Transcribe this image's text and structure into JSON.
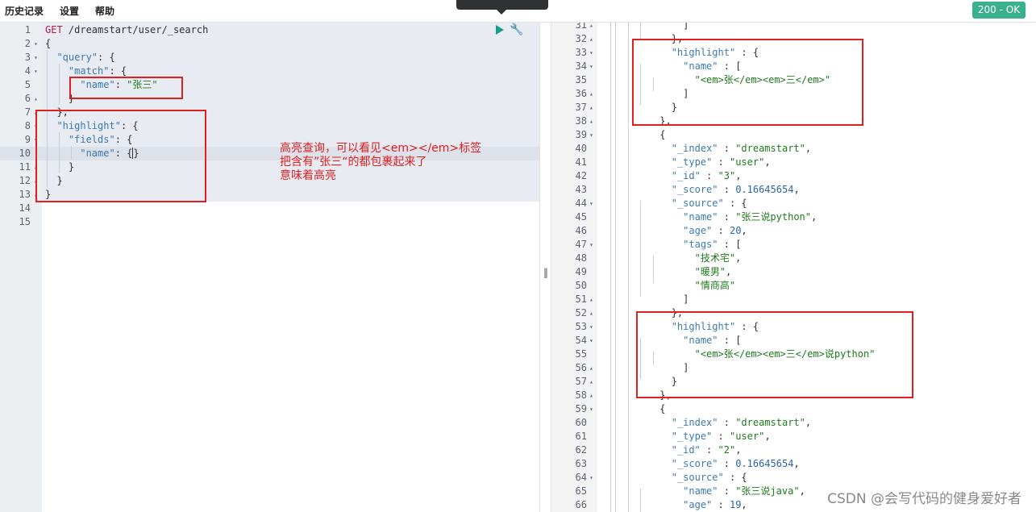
{
  "menu": {
    "history": "历史记录",
    "settings": "设置",
    "help": "帮助"
  },
  "status": "200 - OK",
  "request": {
    "lines": [
      {
        "n": "1",
        "fold": "",
        "html": "<span class='m'>GET</span> /dreamstart/user/_search"
      },
      {
        "n": "2",
        "fold": "▾",
        "html": "{"
      },
      {
        "n": "3",
        "fold": "▾",
        "html": "  <span class='k'>\"query\"</span>: {"
      },
      {
        "n": "4",
        "fold": "▾",
        "html": "    <span class='k'>\"match\"</span>: {"
      },
      {
        "n": "5",
        "fold": "",
        "html": "      <span class='k'>\"name\"</span>: <span class='s'>\"张三\"</span>"
      },
      {
        "n": "6",
        "fold": "▴",
        "html": "    }"
      },
      {
        "n": "7",
        "fold": "▴",
        "html": "  },"
      },
      {
        "n": "8",
        "fold": "▾",
        "html": "  <span class='k'>\"highlight\"</span>: {"
      },
      {
        "n": "9",
        "fold": "▾",
        "html": "    <span class='k'>\"fields\"</span>: {"
      },
      {
        "n": "10",
        "fold": "",
        "html": "      <span class='k'>\"name\"</span>: {|}"
      },
      {
        "n": "11",
        "fold": "▴",
        "html": "    }"
      },
      {
        "n": "12",
        "fold": "▴",
        "html": "  }"
      },
      {
        "n": "13",
        "fold": "▴",
        "html": "}"
      },
      {
        "n": "14",
        "fold": "",
        "html": ""
      },
      {
        "n": "15",
        "fold": "",
        "html": ""
      }
    ]
  },
  "note": {
    "line1": "高亮查询，可以看见<em></em>标签",
    "line2": "把含有”张三“的都包裹起来了",
    "line3": "意味着高亮"
  },
  "response": {
    "lines": [
      {
        "n": "31",
        "fold": "▴",
        "html": "              ]"
      },
      {
        "n": "32",
        "fold": "▴",
        "html": "            },"
      },
      {
        "n": "33",
        "fold": "▾",
        "html": "            <span class='k'>\"highlight\"</span> : {"
      },
      {
        "n": "34",
        "fold": "▾",
        "html": "              <span class='k'>\"name\"</span> : ["
      },
      {
        "n": "35",
        "fold": "",
        "html": "                <span class='s'>\"&lt;em&gt;张&lt;/em&gt;&lt;em&gt;三&lt;/em&gt;\"</span>"
      },
      {
        "n": "36",
        "fold": "▴",
        "html": "              ]"
      },
      {
        "n": "37",
        "fold": "▴",
        "html": "            }"
      },
      {
        "n": "38",
        "fold": "▴",
        "html": "          },"
      },
      {
        "n": "39",
        "fold": "▾",
        "html": "          {"
      },
      {
        "n": "40",
        "fold": "",
        "html": "            <span class='k'>\"_index\"</span> : <span class='s'>\"dreamstart\"</span>,"
      },
      {
        "n": "41",
        "fold": "",
        "html": "            <span class='k'>\"_type\"</span> : <span class='s'>\"user\"</span>,"
      },
      {
        "n": "42",
        "fold": "",
        "html": "            <span class='k'>\"_id\"</span> : <span class='s'>\"3\"</span>,"
      },
      {
        "n": "43",
        "fold": "",
        "html": "            <span class='k'>\"_score\"</span> : <span class='n'>0.16645654</span>,"
      },
      {
        "n": "44",
        "fold": "▾",
        "html": "            <span class='k'>\"_source\"</span> : {"
      },
      {
        "n": "45",
        "fold": "",
        "html": "              <span class='k'>\"name\"</span> : <span class='s'>\"张三说python\"</span>,"
      },
      {
        "n": "46",
        "fold": "",
        "html": "              <span class='k'>\"age\"</span> : <span class='n'>20</span>,"
      },
      {
        "n": "47",
        "fold": "▾",
        "html": "              <span class='k'>\"tags\"</span> : ["
      },
      {
        "n": "48",
        "fold": "",
        "html": "                <span class='s'>\"技术宅\"</span>,"
      },
      {
        "n": "49",
        "fold": "",
        "html": "                <span class='s'>\"暖男\"</span>,"
      },
      {
        "n": "50",
        "fold": "",
        "html": "                <span class='s'>\"情商高\"</span>"
      },
      {
        "n": "51",
        "fold": "▴",
        "html": "              ]"
      },
      {
        "n": "52",
        "fold": "▴",
        "html": "            },"
      },
      {
        "n": "53",
        "fold": "▾",
        "html": "            <span class='k'>\"highlight\"</span> : {"
      },
      {
        "n": "54",
        "fold": "▾",
        "html": "              <span class='k'>\"name\"</span> : ["
      },
      {
        "n": "55",
        "fold": "",
        "html": "                <span class='s'>\"&lt;em&gt;张&lt;/em&gt;&lt;em&gt;三&lt;/em&gt;说python\"</span>"
      },
      {
        "n": "56",
        "fold": "▴",
        "html": "              ]"
      },
      {
        "n": "57",
        "fold": "▴",
        "html": "            }"
      },
      {
        "n": "58",
        "fold": "▴",
        "html": "          },"
      },
      {
        "n": "59",
        "fold": "▾",
        "html": "          {"
      },
      {
        "n": "60",
        "fold": "",
        "html": "            <span class='k'>\"_index\"</span> : <span class='s'>\"dreamstart\"</span>,"
      },
      {
        "n": "61",
        "fold": "",
        "html": "            <span class='k'>\"_type\"</span> : <span class='s'>\"user\"</span>,"
      },
      {
        "n": "62",
        "fold": "",
        "html": "            <span class='k'>\"_id\"</span> : <span class='s'>\"2\"</span>,"
      },
      {
        "n": "63",
        "fold": "",
        "html": "            <span class='k'>\"_score\"</span> : <span class='n'>0.16645654</span>,"
      },
      {
        "n": "64",
        "fold": "▾",
        "html": "            <span class='k'>\"_source\"</span> : {"
      },
      {
        "n": "65",
        "fold": "",
        "html": "              <span class='k'>\"name\"</span> : <span class='s'>\"张三说java\"</span>,"
      },
      {
        "n": "66",
        "fold": "",
        "html": "              <span class='k'>\"age\"</span> : <span class='n'>19</span>,"
      }
    ]
  },
  "watermark": "CSDN @会写代码的健身爱好者"
}
